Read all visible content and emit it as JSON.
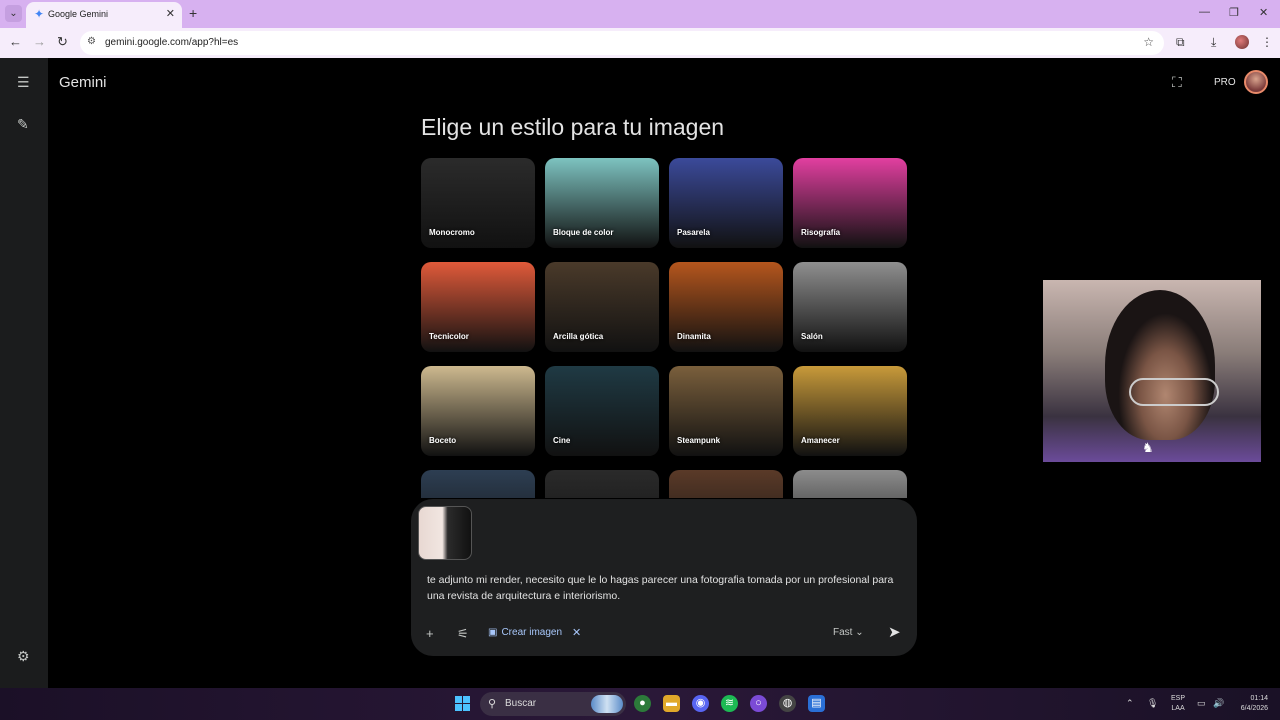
{
  "browser": {
    "tab_title": "Google Gemini",
    "url": "gemini.google.com/app?hl=es"
  },
  "app": {
    "brand": "Gemini",
    "plan_badge": "PRO"
  },
  "main": {
    "heading": "Elige un estilo para tu imagen",
    "styles": [
      {
        "label": "Monocromo",
        "color": "#2b2b2b"
      },
      {
        "label": "Bloque de color",
        "color": "#7dc3c0"
      },
      {
        "label": "Pasarela",
        "color": "#3b4a9a"
      },
      {
        "label": "Risografía",
        "color": "#e23fa0"
      },
      {
        "label": "Tecnicolor",
        "color": "#e05a3a"
      },
      {
        "label": "Arcilla gótica",
        "color": "#4a3a2a"
      },
      {
        "label": "Dinamita",
        "color": "#b5561d"
      },
      {
        "label": "Salón",
        "color": "#8f8f8f"
      },
      {
        "label": "Boceto",
        "color": "#cdb98f"
      },
      {
        "label": "Cine",
        "color": "#1f3a44"
      },
      {
        "label": "Steampunk",
        "color": "#7a5f3c"
      },
      {
        "label": "Amanecer",
        "color": "#c89a3a"
      },
      {
        "label": "",
        "color": "#2d3e52"
      },
      {
        "label": "",
        "color": "#2a2a2a"
      },
      {
        "label": "",
        "color": "#5a3a28"
      },
      {
        "label": "",
        "color": "#8c8c8c"
      }
    ]
  },
  "composer": {
    "prompt": "te adjunto mi render, necesito que le lo hagas parecer una fotografia tomada por un profesional para una revista de arquitectura e interiorismo.",
    "create_image_label": "Crear imagen",
    "model_label": "Fast"
  },
  "taskbar": {
    "search_label": "Buscar",
    "lang_line1": "ESP",
    "lang_line2": "LAA",
    "time": "01:14",
    "date": "6/4/2026"
  },
  "icons": {
    "tab_list": "chevron-down-icon",
    "gemini_favicon": "sparkle-icon",
    "menu": "hamburger-menu-icon",
    "new_chat": "edit-icon",
    "settings": "gear-icon",
    "add": "plus-icon",
    "tools": "tune-icon",
    "send": "send-icon"
  }
}
